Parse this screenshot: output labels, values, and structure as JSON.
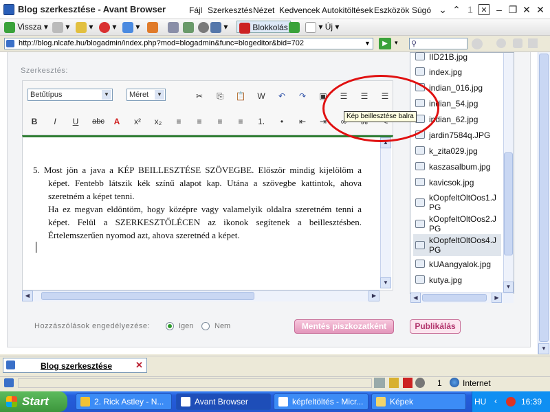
{
  "window": {
    "title": "Blog szerkesztése - Avant Browser"
  },
  "menu": [
    "Fájl",
    "Szerkesztés",
    "Nézet",
    "Kedvencek",
    "Autokitöltések",
    "Eszközök",
    "Súgó"
  ],
  "window_controls": {
    "counter": "1"
  },
  "toolbar": {
    "back_label": "Vissza",
    "popup_block_label": "Blokkolás",
    "new_label": "Új"
  },
  "address": {
    "url": "http://blog.nlcafe.hu/blogadmin/index.php?mod=blogadmin&func=blogeditor&bid=702"
  },
  "page": {
    "section_label": "Szerkesztés:",
    "font_select": "Betűtípus",
    "size_select": "Méret",
    "format_buttons": [
      "B",
      "I",
      "U",
      "abc",
      "A",
      "x²",
      "x₂"
    ],
    "tooltip": "Kép beillesztése balra",
    "content": [
      "5.  Most jön a java a KÉP BEILLESZTÉSE SZÖVEGBE. Először mindig kijelölöm a képet. Fentebb látszik kék színű alapot kap. Utána a szövegbe kattintok, ahova szeretném a képet tenni.",
      "Ha ez megvan eldöntöm, hogy középre vagy valamelyik oldalra szeretném tenni a képet. Felül a SZERKESZTŐLÉCEN az ikonok segítenek a beillesztésben. Értelemszerűen nyomod azt, ahova szeretnéd a képet."
    ],
    "comments_label": "Hozzászólások engedélyezése:",
    "radio_yes": "Igen",
    "radio_no": "Nem",
    "save_draft_label": "Mentés piszkozatként",
    "publish_label": "Publikálás"
  },
  "files": [
    {
      "name": "IID21B.jpg"
    },
    {
      "name": "index.jpg"
    },
    {
      "name": "indian_016.jpg"
    },
    {
      "name": "indian_54.jpg"
    },
    {
      "name": "indian_62.jpg"
    },
    {
      "name": "jardin7584q.JPG"
    },
    {
      "name": "k_zita029.jpg"
    },
    {
      "name": "kaszasalbum.jpg"
    },
    {
      "name": "kavicsok.jpg"
    },
    {
      "name": "kOopfeltOltOos1.JPG"
    },
    {
      "name": "kOopfeltOltOos2.JPG"
    },
    {
      "name": "kOopfeltOltOos4.JPG"
    },
    {
      "name": "kUAangyalok.jpg"
    },
    {
      "name": "kutya.jpg"
    }
  ],
  "tab": {
    "label": "Blog szerkesztése"
  },
  "status": {
    "count": "1",
    "zone": "Internet"
  },
  "taskbar": {
    "start_label": "Start",
    "items": [
      "2. Rick Astley - N...",
      "Avant Browser",
      "képfeltöltés - Micr...",
      "Képek"
    ],
    "lang": "HU",
    "clock": "16:39"
  }
}
